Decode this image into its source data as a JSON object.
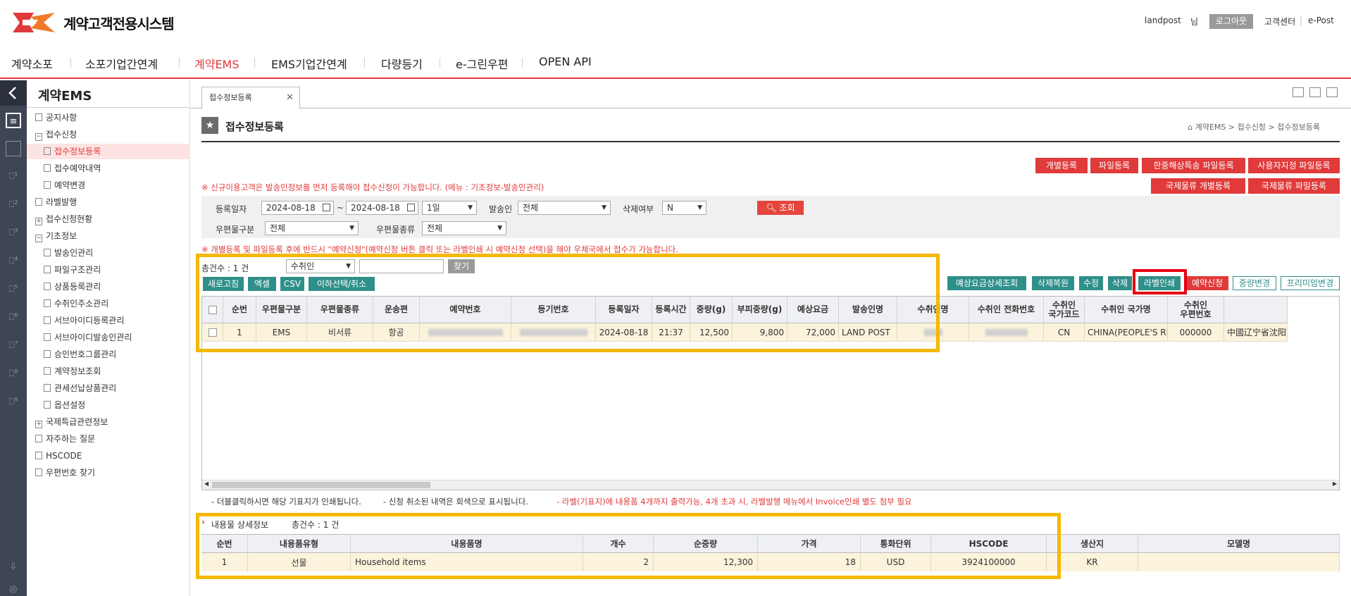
{
  "header": {
    "brand": "계약고객전용시스템",
    "user": "landpost",
    "user_suffix": "님",
    "logout": "로그아웃",
    "help_center": "고객센터",
    "epost": "e-Post",
    "brand_color": "#e03a3a"
  },
  "nav": {
    "items": [
      "계약소포",
      "소포기업간연계",
      "계약EMS",
      "EMS기업간연계",
      "다량등기",
      "e-그린우편",
      "OPEN API"
    ],
    "active": "계약EMS"
  },
  "sidebar": {
    "title": "계약EMS",
    "items": [
      {
        "label": "공지사항",
        "level": 0,
        "icon": "doc-icon"
      },
      {
        "label": "접수신청",
        "level": 0,
        "icon": "minus-box-icon"
      },
      {
        "label": "접수정보등록",
        "level": 1,
        "icon": "doc-icon",
        "selected": true
      },
      {
        "label": "접수예약내역",
        "level": 1,
        "icon": "doc-icon"
      },
      {
        "label": "예약변경",
        "level": 1,
        "icon": "doc-icon"
      },
      {
        "label": "라벨발행",
        "level": 0,
        "icon": "doc-icon"
      },
      {
        "label": "접수신청현황",
        "level": 0,
        "icon": "plus-box-icon"
      },
      {
        "label": "기초정보",
        "level": 0,
        "icon": "minus-box-icon"
      },
      {
        "label": "발송인관리",
        "level": 1,
        "icon": "doc-icon"
      },
      {
        "label": "파일구조관리",
        "level": 1,
        "icon": "doc-icon"
      },
      {
        "label": "상품등록관리",
        "level": 1,
        "icon": "doc-icon"
      },
      {
        "label": "수취인주소관리",
        "level": 1,
        "icon": "doc-icon"
      },
      {
        "label": "서브아이디등록관리",
        "level": 1,
        "icon": "doc-icon"
      },
      {
        "label": "서브아이디발송인관리",
        "level": 1,
        "icon": "doc-icon"
      },
      {
        "label": "승인번호그룹관리",
        "level": 1,
        "icon": "doc-icon"
      },
      {
        "label": "계약정보조회",
        "level": 1,
        "icon": "doc-icon"
      },
      {
        "label": "관세선납상품관리",
        "level": 1,
        "icon": "doc-icon"
      },
      {
        "label": "옵션설정",
        "level": 1,
        "icon": "doc-icon"
      },
      {
        "label": "국제특급관련정보",
        "level": 0,
        "icon": "plus-box-icon"
      },
      {
        "label": "자주하는 질문",
        "level": 0,
        "icon": "doc-icon"
      },
      {
        "label": "HSCODE",
        "level": 0,
        "icon": "doc-icon"
      },
      {
        "label": "우편번호 찾기",
        "level": 0,
        "icon": "doc-icon"
      }
    ]
  },
  "tabs": {
    "open_tab": "접수정보등록"
  },
  "page": {
    "title": "접수정보등록",
    "breadcrumb": "계약EMS > 접수신청 > 접수정보등록"
  },
  "top_buttons": [
    "개별등록",
    "파일등록",
    "한중해상특송 파일등록",
    "사용자지정 파일등록",
    "국제물류 개별등록",
    "국제물류 파일등록"
  ],
  "notice1": "※ 신규이용고객은 발송인정보를 먼저 등록해야 접수신청이 가능합니다. (메뉴 : 기초정보-발송인관리)",
  "filters": {
    "reg_date_label": "등록일자",
    "date_from": "2024-08-18",
    "tilde": "~",
    "date_to": "2024-08-18",
    "period": "1일",
    "sender_label": "발송인",
    "sender_value": "전체",
    "deleted_label": "삭제여부",
    "deleted_value": "N",
    "search_button": "조회",
    "mail_type_label": "우편물구분",
    "mail_type_value": "전체",
    "mail_kind_label": "우편물종류",
    "mail_kind_value": "전체"
  },
  "notice2": "※ 개별등록 및 파일등록 후에 반드시 \"예약신청\"(예약신청 버튼 클릭 또는 라벨인쇄 시 예약신청 선택)을 해야 우체국에서 접수가 가능합니다.",
  "list_toolbar": {
    "total": "총건수 : 1 건",
    "search_field": "수취인",
    "search_input": "",
    "find_button": "찾기",
    "left_buttons": [
      "새로고침",
      "엑셀",
      "CSV",
      "이하선택/취소"
    ],
    "right_buttons": [
      "예상요금상세조회",
      "삭제복원",
      "수정",
      "삭제",
      "라벨인쇄",
      "예약신청",
      "중량변경",
      "프리미엄변경"
    ]
  },
  "grid": {
    "columns": [
      "",
      "순번",
      "우편물구분",
      "우편물종류",
      "운송편",
      "예약번호",
      "등기번호",
      "등록일자",
      "등록시간",
      "중량(g)",
      "부피중량(g)",
      "예상요금",
      "발송인명",
      "수취인명",
      "수취인 전화번호",
      "수취인\n국가코드",
      "수취인 국가명",
      "수취인\n우편번호",
      ""
    ],
    "rows": [
      [
        "",
        "1",
        "EMS",
        "비서류",
        "항공",
        "",
        "",
        "2024-08-18",
        "21:37",
        "12,500",
        "9,800",
        "72,000",
        "LAND POST",
        "",
        "",
        "CN",
        "CHINA(PEOPLE'S REP",
        "000000",
        "中國辽宁省沈阳市"
      ]
    ]
  },
  "grid_notes": {
    "note1": "- 더블클릭하시면 해당 기표지가 인쇄됩니다.",
    "note2": "- 신청 취소된 내역은 회색으로 표시됩니다.",
    "note3": "- 라벨(기표지)에 내용품 4개까지 출력가능, 4개 초과 시, 라벨발행 메뉴에서 Invoice인쇄 별도 첨부 필요"
  },
  "detail": {
    "title": "내용물 상세정보",
    "total": "총건수 : 1 건",
    "columns": [
      "순번",
      "내용품유형",
      "내용품명",
      "개수",
      "순중량",
      "가격",
      "통화단위",
      "HSCODE",
      "생산지",
      "모델명"
    ],
    "rows": [
      [
        "1",
        "선물",
        "Household items",
        "2",
        "12,300",
        "18",
        "USD",
        "3924100000",
        "KR",
        ""
      ]
    ]
  }
}
